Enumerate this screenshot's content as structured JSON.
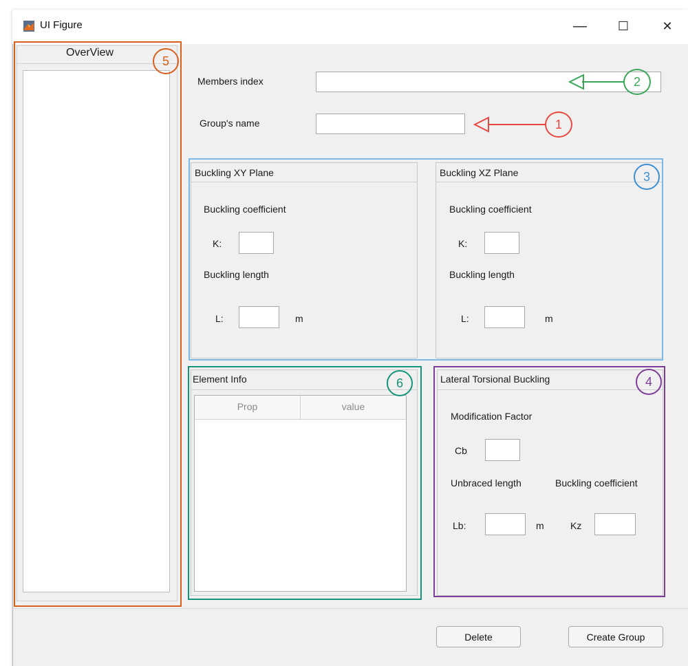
{
  "window": {
    "title": "UI Figure",
    "controls": {
      "minimize": "—",
      "maximize": "☐",
      "close": "✕"
    }
  },
  "overview": {
    "title": "OverView"
  },
  "members": {
    "label": "Members index",
    "value": ""
  },
  "group": {
    "label": "Group's name",
    "value": ""
  },
  "buckling_xy": {
    "title": "Buckling XY Plane",
    "coef_label": "Buckling coefficient",
    "k_label": "K:",
    "k_value": "",
    "len_label": "Buckling length",
    "l_label": "L:",
    "l_value": "",
    "unit": "m"
  },
  "buckling_xz": {
    "title": "Buckling XZ Plane",
    "coef_label": "Buckling coefficient",
    "k_label": "K:",
    "k_value": "",
    "len_label": "Buckling length",
    "l_label": "L:",
    "l_value": "",
    "unit": "m"
  },
  "element_info": {
    "title": "Element Info",
    "columns": [
      "Prop",
      "value"
    ]
  },
  "ltb": {
    "title": "Lateral Torsional Buckling",
    "mod_label": "Modification Factor",
    "cb_label": "Cb",
    "cb_value": "",
    "unbraced_label": "Unbraced length",
    "coef_label": "Buckling coefficient",
    "lb_label": "Lb:",
    "lb_value": "",
    "unit": "m",
    "kz_label": "Kz",
    "kz_value": ""
  },
  "buttons": {
    "delete": "Delete",
    "create": "Create Group"
  },
  "annotations": {
    "n1": "1",
    "n2": "2",
    "n3": "3",
    "n4": "4",
    "n5": "5",
    "n6": "6"
  },
  "colors": {
    "red": "#e8473f",
    "green": "#3aa657",
    "blue": "#3d8fd1",
    "purple": "#7d3c98",
    "orange": "#d9601a",
    "teal": "#13937a"
  }
}
